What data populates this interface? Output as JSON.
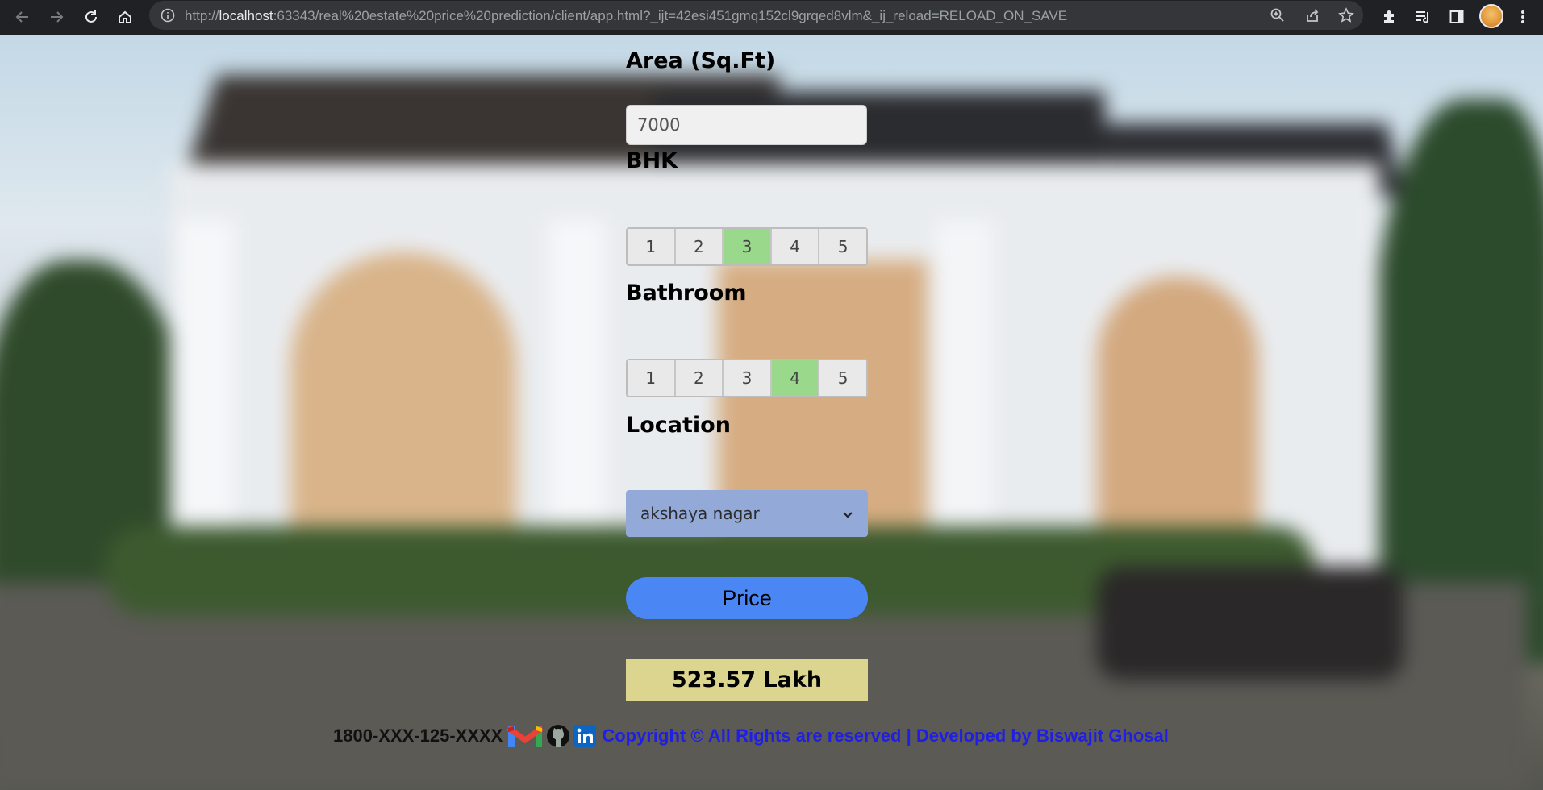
{
  "browser": {
    "url_host": "localhost",
    "url_scheme": "http://",
    "url_rest": ":63343/real%20estate%20price%20prediction/client/app.html?_ijt=42esi451gmq152cl9grqed8vlm&_ij_reload=RELOAD_ON_SAVE"
  },
  "form": {
    "area_label": "Area (Sq.Ft)",
    "area_value": "7000",
    "bhk_label": "BHK",
    "bhk_options": [
      "1",
      "2",
      "3",
      "4",
      "5"
    ],
    "bhk_selected": "3",
    "bath_label": "Bathroom",
    "bath_options": [
      "1",
      "2",
      "3",
      "4",
      "5"
    ],
    "bath_selected": "4",
    "location_label": "Location",
    "location_value": "akshaya nagar",
    "price_button": "Price",
    "result": "523.57 Lakh"
  },
  "footer": {
    "phone": "1800-XXX-125-XXXX",
    "copyright": "Copyright © All Rights are reserved | Developed by Biswajit Ghosal"
  },
  "colors": {
    "selected_option": "#9ad98c",
    "price_button": "#4a87f5",
    "result_bg": "#dcd58f",
    "location_bg": "#93a9d8",
    "copyright_text": "#1e1ee8"
  },
  "icons": [
    "back-icon",
    "forward-icon",
    "reload-icon",
    "home-icon",
    "info-icon",
    "zoom-icon",
    "share-icon",
    "star-icon",
    "extensions-icon",
    "reading-list-icon",
    "side-panel-icon",
    "menu-icon",
    "gmail-icon",
    "github-icon",
    "linkedin-icon"
  ]
}
